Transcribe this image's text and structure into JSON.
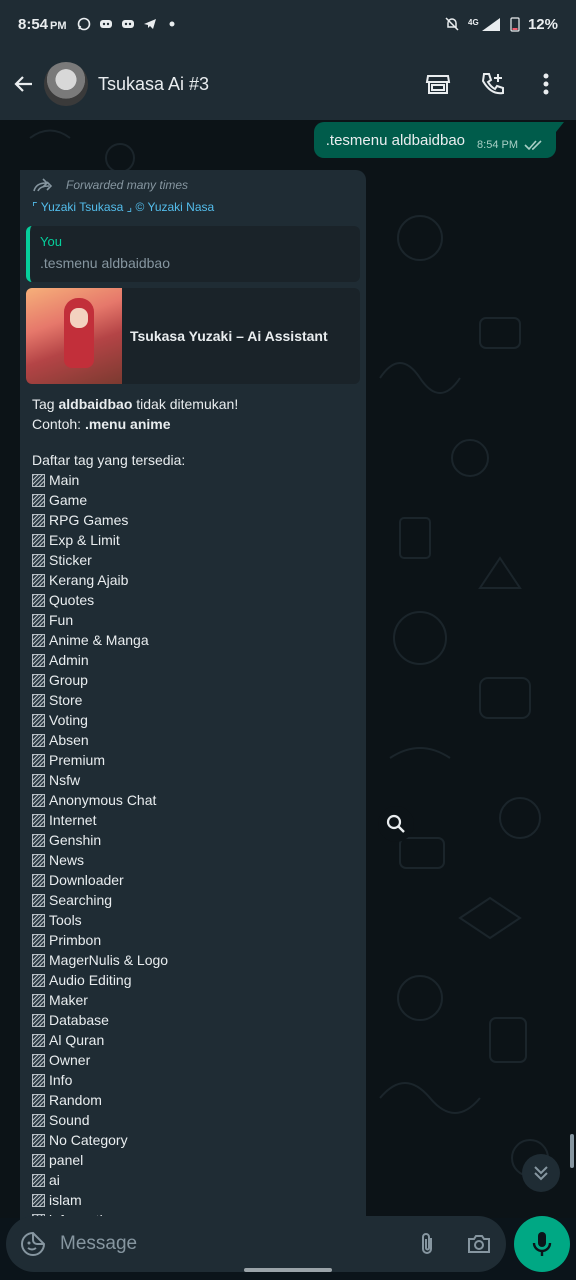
{
  "status_bar": {
    "time": "8:54",
    "time_suffix": "PM",
    "battery": "12%",
    "left_icons": [
      "whatsapp-icon",
      "discord-icon",
      "discord-icon",
      "telegram-icon",
      "dot-icon"
    ],
    "right_icons": [
      "bell-off-icon",
      "signal-icon",
      "battery-icon"
    ]
  },
  "header": {
    "title": "Tsukasa Ai #3",
    "actions": [
      "store-icon",
      "add-call-icon",
      "more-vert-icon"
    ]
  },
  "outgoing": {
    "text": ".tesmenu aldbaidbao",
    "time": "8:54 PM"
  },
  "incoming": {
    "forwarded_label": "Forwarded many times",
    "sender": "⌜ Yuzaki Tsukasa ⌟ © Yuzaki Nasa",
    "quote_name": "You",
    "quote_text": ".tesmenu aldbaidbao",
    "link_title": "Tsukasa Yuzaki – Ai Assistant",
    "line1_prefix": "Tag ",
    "line1_bold": "aldbaidbao",
    "line1_suffix": " tidak ditemukan!",
    "line2_prefix": "Contoh: ",
    "line2_bold": ".menu anime",
    "list_heading": "Daftar tag yang tersedia:",
    "tags": [
      "Main",
      "Game",
      "RPG Games",
      "Exp & Limit",
      "Sticker",
      "Kerang Ajaib",
      "Quotes",
      "Fun",
      "Anime & Manga",
      "Admin",
      "Group",
      "Store",
      "Voting",
      "Absen",
      "Premium",
      "Nsfw",
      "Anonymous Chat",
      "Internet",
      "Genshin",
      "News",
      "Downloader",
      "Searching",
      "Tools",
      "Primbon",
      "MagerNulis & Logo",
      "Audio Editing",
      "Maker",
      "Database",
      "Al Quran",
      "Owner",
      "Info",
      "Random",
      "Sound",
      "No Category",
      "panel",
      "ai",
      "islam",
      "information"
    ]
  },
  "composer": {
    "placeholder": "Message"
  },
  "colors": {
    "header_bg": "#1f2c34",
    "outgoing_bg": "#005c4b",
    "incoming_bg": "#1f2c34",
    "accent": "#00a884",
    "link": "#53bdeb"
  }
}
